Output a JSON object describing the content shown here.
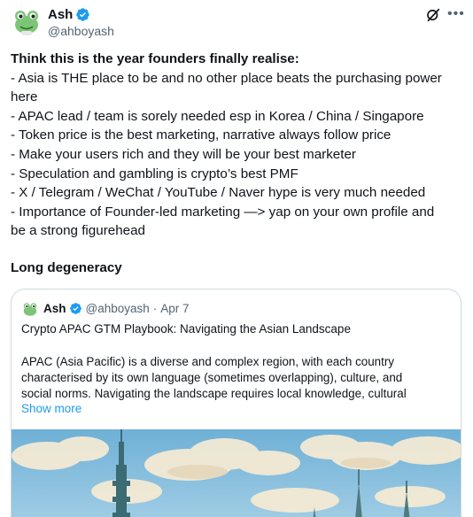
{
  "author": {
    "name": "Ash",
    "handle": "@ahboyash"
  },
  "post": {
    "lines": [
      "Think this is the year founders finally realise:",
      "- Asia is THE place to be and no other place beats the purchasing power",
      "here",
      "- APAC lead / team is sorely needed esp in Korea / China / Singapore",
      "- Token price is the best marketing, narrative always follow price",
      "- Make your users rich and they will be your best marketer",
      "- Speculation and gambling is crypto’s best PMF",
      "- X / Telegram / WeChat / YouTube / Naver hype is very much needed",
      "- Importance of Founder-led marketing —> yap on your own profile and",
      "be a strong figurehead"
    ],
    "subheading": "Long degeneracy"
  },
  "quote": {
    "name": "Ash",
    "handle": "@ahboyash",
    "separator": "·",
    "date": "Apr 7",
    "title": "Crypto APAC GTM Playbook: Navigating the Asian Landscape",
    "body_lines": [
      "APAC (Asia Pacific) is a diverse and complex region, with each country",
      "characterised by its own language (sometimes overlapping), culture, and",
      "social norms. Navigating the landscape requires local knowledge, cultural"
    ],
    "show_more": "Show more"
  },
  "colors": {
    "accent": "#1d9bf0",
    "text": "#0f1419",
    "muted": "#536471",
    "border": "#cfd9de"
  },
  "icons": [
    "frog-avatar",
    "verified-badge-icon",
    "grok-icon",
    "more-icon"
  ]
}
